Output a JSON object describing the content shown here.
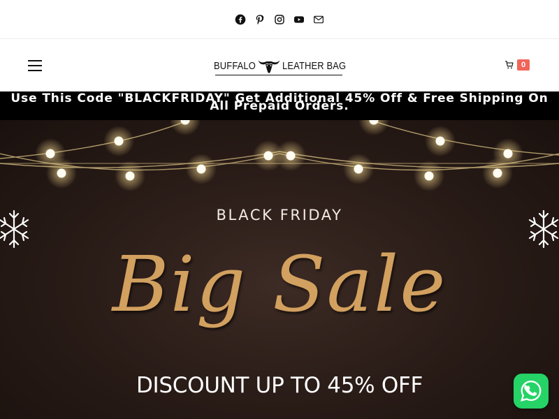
{
  "social": {
    "icons": [
      "facebook-icon",
      "pinterest-icon",
      "instagram-icon",
      "youtube-icon",
      "mail-icon"
    ]
  },
  "header": {
    "logo_left": "BUFFALO",
    "logo_right": "LEATHER BAG",
    "cart_count": "0",
    "menu_icon": "hamburger-menu-icon",
    "cart_icon": "shopping-cart-icon"
  },
  "promo": {
    "text": "Use This Code \"BLACKFRIDAY\" Get Additional 45% Off & Free Shipping On All Prepaid Orders."
  },
  "hero": {
    "kicker": "BLACK FRIDAY",
    "title": "Big Sale",
    "subtitle": "DISCOUNT UP TO 45% OFF"
  },
  "chat": {
    "icon": "whatsapp-icon"
  },
  "colors": {
    "accent_gold": "#d2a05f",
    "cart_badge": "#f2645a",
    "whatsapp_green": "#25d366",
    "promo_bg": "#000000",
    "hero_bg": "#2b1d18"
  }
}
